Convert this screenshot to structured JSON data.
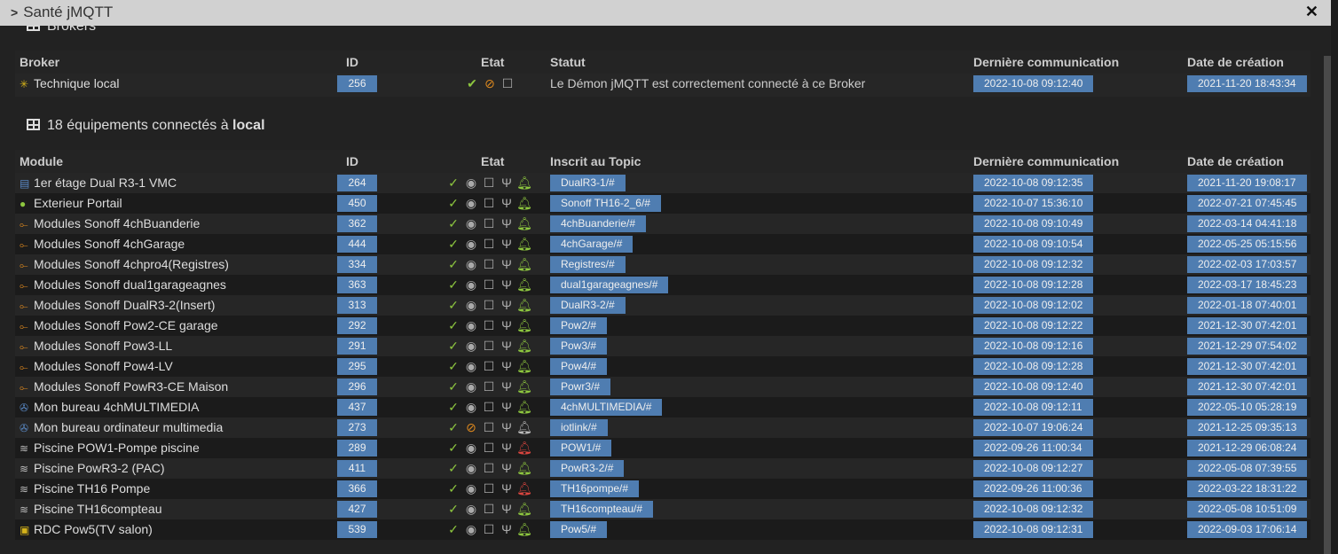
{
  "window": {
    "title": "Santé jMQTT",
    "close": "✕"
  },
  "brokers": {
    "title": "Brokers",
    "headers": [
      "Broker",
      "ID",
      "Etat",
      "Statut",
      "Dernière communication",
      "Date de création"
    ],
    "rows": [
      {
        "name": "Technique local",
        "id": "256",
        "status": "Le Démon jMQTT est correctement connecté à ce Broker",
        "last": "2022-10-08 09:12:40",
        "created": "2021-11-20 18:43:34"
      }
    ]
  },
  "equipments": {
    "title_prefix": "18 équipements connectés à",
    "title_broker": "local",
    "headers": [
      "Module",
      "ID",
      "Etat",
      "Inscrit au Topic",
      "Dernière communication",
      "Date de création"
    ],
    "rows": [
      {
        "icon": "vmc",
        "name": "1er étage Dual R3-1 VMC",
        "id": "264",
        "topic": "DualR3-1/#",
        "last": "2022-10-08 09:12:35",
        "created": "2021-11-20 19:08:17",
        "eye": "on",
        "bell": "green"
      },
      {
        "icon": "tree",
        "name": "Exterieur Portail",
        "id": "450",
        "topic": "Sonoff TH16-2_6/#",
        "last": "2022-10-07 15:36:10",
        "created": "2022-07-21 07:45:45",
        "eye": "on",
        "bell": "green"
      },
      {
        "icon": "module",
        "name": "Modules Sonoff 4chBuanderie",
        "id": "362",
        "topic": "4chBuanderie/#",
        "last": "2022-10-08 09:10:49",
        "created": "2022-03-14 04:41:18",
        "eye": "on",
        "bell": "green"
      },
      {
        "icon": "module",
        "name": "Modules Sonoff 4chGarage",
        "id": "444",
        "topic": "4chGarage/#",
        "last": "2022-10-08 09:10:54",
        "created": "2022-05-25 05:15:56",
        "eye": "on",
        "bell": "green"
      },
      {
        "icon": "module",
        "name": "Modules Sonoff 4chpro4(Registres)",
        "id": "334",
        "topic": "Registres/#",
        "last": "2022-10-08 09:12:32",
        "created": "2022-02-03 17:03:57",
        "eye": "on",
        "bell": "green"
      },
      {
        "icon": "module",
        "name": "Modules Sonoff dual1garageagnes",
        "id": "363",
        "topic": "dual1garageagnes/#",
        "last": "2022-10-08 09:12:28",
        "created": "2022-03-17 18:45:23",
        "eye": "on",
        "bell": "green"
      },
      {
        "icon": "module",
        "name": "Modules Sonoff DualR3-2(Insert)",
        "id": "313",
        "topic": "DualR3-2/#",
        "last": "2022-10-08 09:12:02",
        "created": "2022-01-18 07:40:01",
        "eye": "on",
        "bell": "green"
      },
      {
        "icon": "module",
        "name": "Modules Sonoff Pow2-CE garage",
        "id": "292",
        "topic": "Pow2/#",
        "last": "2022-10-08 09:12:22",
        "created": "2021-12-30 07:42:01",
        "eye": "on",
        "bell": "green"
      },
      {
        "icon": "module",
        "name": "Modules Sonoff Pow3-LL",
        "id": "291",
        "topic": "Pow3/#",
        "last": "2022-10-08 09:12:16",
        "created": "2021-12-29 07:54:02",
        "eye": "on",
        "bell": "green"
      },
      {
        "icon": "module",
        "name": "Modules Sonoff Pow4-LV",
        "id": "295",
        "topic": "Pow4/#",
        "last": "2022-10-08 09:12:28",
        "created": "2021-12-30 07:42:01",
        "eye": "on",
        "bell": "green"
      },
      {
        "icon": "module",
        "name": "Modules Sonoff PowR3-CE Maison",
        "id": "296",
        "topic": "Powr3/#",
        "last": "2022-10-08 09:12:40",
        "created": "2021-12-30 07:42:01",
        "eye": "on",
        "bell": "green"
      },
      {
        "icon": "film",
        "name": "Mon bureau 4chMULTIMEDIA",
        "id": "437",
        "topic": "4chMULTIMEDIA/#",
        "last": "2022-10-08 09:12:11",
        "created": "2022-05-10 05:28:19",
        "eye": "on",
        "bell": "green"
      },
      {
        "icon": "film",
        "name": "Mon bureau ordinateur multimedia",
        "id": "273",
        "topic": "iotlink/#",
        "last": "2022-10-07 19:06:24",
        "created": "2021-12-25 09:35:13",
        "eye": "off",
        "bell": "none"
      },
      {
        "icon": "pool",
        "name": "Piscine POW1-Pompe piscine",
        "id": "289",
        "topic": "POW1/#",
        "last": "2022-09-26 11:00:34",
        "created": "2021-12-29 06:08:24",
        "eye": "on",
        "bell": "red"
      },
      {
        "icon": "pool",
        "name": "Piscine PowR3-2 (PAC)",
        "id": "411",
        "topic": "PowR3-2/#",
        "last": "2022-10-08 09:12:27",
        "created": "2022-05-08 07:39:55",
        "eye": "on",
        "bell": "green"
      },
      {
        "icon": "pool",
        "name": "Piscine TH16 Pompe",
        "id": "366",
        "topic": "TH16pompe/#",
        "last": "2022-09-26 11:00:36",
        "created": "2022-03-22 18:31:22",
        "eye": "on",
        "bell": "red"
      },
      {
        "icon": "pool",
        "name": "Piscine TH16compteau",
        "id": "427",
        "topic": "TH16compteau/#",
        "last": "2022-10-08 09:12:32",
        "created": "2022-05-08 10:51:09",
        "eye": "on",
        "bell": "green"
      },
      {
        "icon": "tv",
        "name": "RDC Pow5(TV salon)",
        "id": "539",
        "topic": "Pow5/#",
        "last": "2022-10-08 09:12:31",
        "created": "2022-09-03 17:06:14",
        "eye": "on",
        "bell": "green"
      }
    ]
  },
  "colors": {
    "badge": "#4f7db1",
    "green": "#8dc63f",
    "orange": "#e08a1e",
    "red": "#d9453f",
    "gray": "#aaa"
  }
}
